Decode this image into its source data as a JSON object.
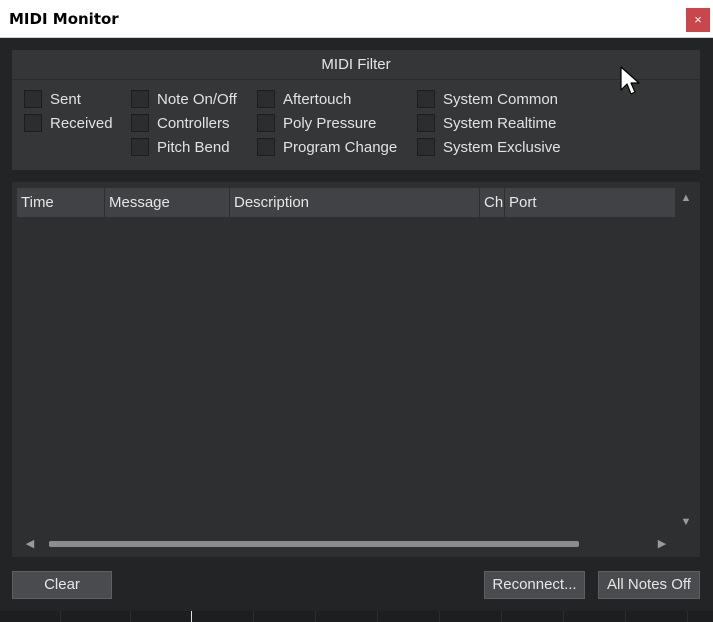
{
  "window": {
    "title": "MIDI Monitor",
    "close_label": "×"
  },
  "filter": {
    "title": "MIDI Filter",
    "options": [
      {
        "label": "Sent",
        "checked": false
      },
      {
        "label": "Received",
        "checked": false
      },
      {
        "label": "Note On/Off",
        "checked": false
      },
      {
        "label": "Controllers",
        "checked": false
      },
      {
        "label": "Pitch Bend",
        "checked": false
      },
      {
        "label": "Aftertouch",
        "checked": false
      },
      {
        "label": "Poly Pressure",
        "checked": false
      },
      {
        "label": "Program Change",
        "checked": false
      },
      {
        "label": "System Common",
        "checked": false
      },
      {
        "label": "System Realtime",
        "checked": false
      },
      {
        "label": "System Exclusive",
        "checked": false
      }
    ]
  },
  "table": {
    "columns": [
      "Time",
      "Message",
      "Description",
      "Ch",
      "Port"
    ],
    "rows": []
  },
  "buttons": {
    "clear": "Clear",
    "reconnect": "Reconnect...",
    "all_notes_off": "All Notes Off"
  },
  "icons": {
    "close": "close-icon",
    "scroll_up": "scroll-up-arrow-icon",
    "scroll_down": "scroll-down-arrow-icon",
    "scroll_left": "scroll-left-arrow-icon",
    "scroll_right": "scroll-right-arrow-icon",
    "cursor": "mouse-pointer-icon"
  },
  "colors": {
    "background": "#232426",
    "panel": "#353638",
    "close_button": "#c9464a"
  }
}
